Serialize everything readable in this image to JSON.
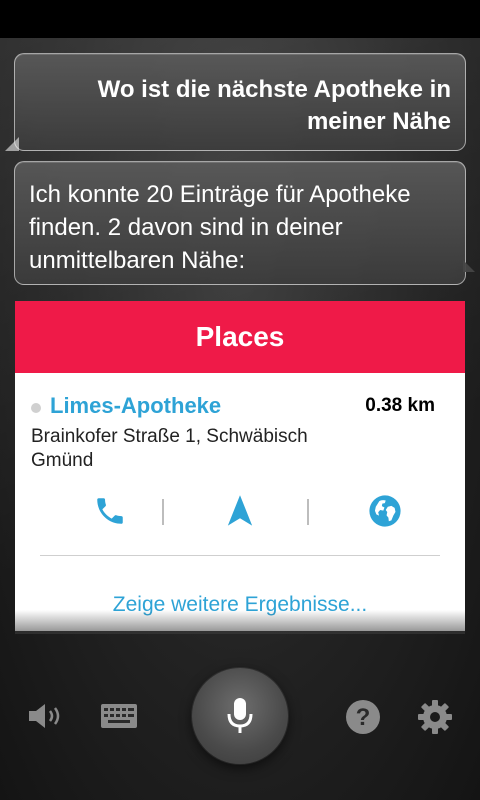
{
  "conversation": {
    "user_query": "Wo ist die nächste Apotheke in meiner Nähe",
    "assistant_reply": "Ich konnte 20 Einträge für Apotheke finden. 2 davon sind in deiner unmittelbaren Nähe:"
  },
  "card": {
    "title": "Places",
    "header_color": "#ef1a48",
    "accent_color": "#2ea3d6",
    "result": {
      "name": "Limes-Apotheke",
      "distance": "0.38 km",
      "address": "Brainkofer Straße 1, Schwäbisch Gmünd"
    },
    "actions": [
      "phone-icon",
      "navigation-arrow-icon",
      "globe-icon"
    ],
    "more_results_label": "Zeige weitere Ergebnisse..."
  },
  "bottom_bar": {
    "icons": [
      "speaker-icon",
      "keyboard-icon",
      "microphone-icon",
      "help-icon",
      "settings-gear-icon"
    ]
  }
}
